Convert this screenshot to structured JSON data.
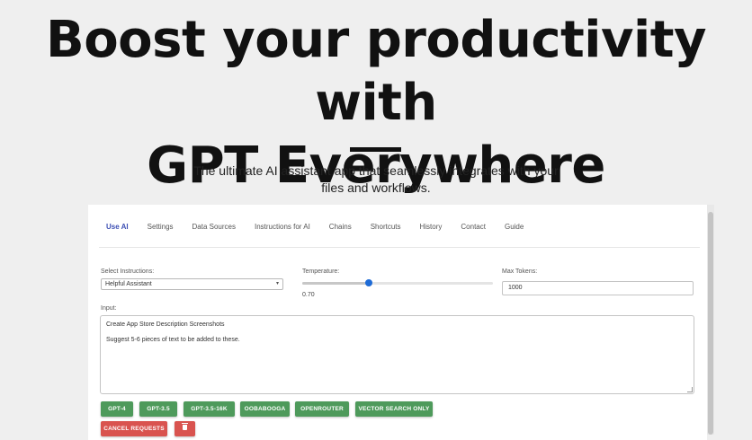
{
  "hero": {
    "title_line1": "Boost your productivity with",
    "title_line2": "GPT Everywhere",
    "subtitle_line1": "The ultimate AI assistant app that seamlessly integrates with your",
    "subtitle_line2": "files and workflows."
  },
  "tabs": [
    {
      "label": "Use AI",
      "active": true
    },
    {
      "label": "Settings",
      "active": false
    },
    {
      "label": "Data Sources",
      "active": false
    },
    {
      "label": "Instructions for AI",
      "active": false
    },
    {
      "label": "Chains",
      "active": false
    },
    {
      "label": "Shortcuts",
      "active": false
    },
    {
      "label": "History",
      "active": false
    },
    {
      "label": "Contact",
      "active": false
    },
    {
      "label": "Guide",
      "active": false
    }
  ],
  "instructions": {
    "label": "Select Instructions:",
    "selected": "Helpful Assistant",
    "chevron_icon": "chevron-down-icon"
  },
  "temperature": {
    "label": "Temperature:",
    "value_text": "0.70",
    "value": 0.7
  },
  "max_tokens": {
    "label": "Max Tokens:",
    "value": "1000"
  },
  "input": {
    "label": "Input:",
    "line1": "Create App Store Description Screenshots",
    "line2": "Suggest 5-6 pieces of text to be added to these."
  },
  "model_buttons": [
    "GPT-4",
    "GPT-3.5",
    "GPT-3.5-16K",
    "OOBABOOGA",
    "OPENROUTER",
    "VECTOR SEARCH ONLY"
  ],
  "actions": {
    "cancel_label": "CANCEL REQUESTS",
    "trash_icon": "trash-icon"
  },
  "colors": {
    "accent": "#3f51b5",
    "green_button": "#4e9a5b",
    "red_button": "#d9534f",
    "slider_thumb": "#1e6bd6"
  }
}
